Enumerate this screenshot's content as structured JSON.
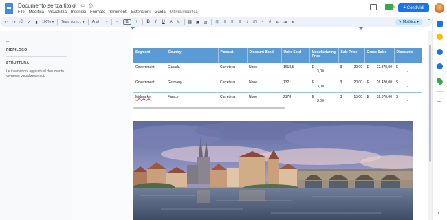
{
  "app": {
    "doc_title": "Documento senza titolo",
    "menu": [
      "File",
      "Modifica",
      "Visualizza",
      "Inserisci",
      "Formato",
      "Strumenti",
      "Estensioni",
      "Guida"
    ],
    "last_modified": "Ultima modifica"
  },
  "header": {
    "share_label": "Condividi"
  },
  "toolbar": {
    "zoom": "100%",
    "style": "Testo norm...",
    "font": "Arial",
    "font_size": "11",
    "mode": "Modifica"
  },
  "left_panel": {
    "summary_label": "RIEPILOGO",
    "structure_label": "STRUTTURA",
    "structure_hint": "Le intestazioni aggiunte al documento verranno visualizzate qui."
  },
  "table": {
    "headers": [
      "Segment",
      "Country",
      "Product",
      "Discount Band",
      "Units Sold",
      "Manufacturing Price",
      "Sale Price",
      "Gross Sales",
      "Discounts"
    ],
    "rows": [
      {
        "segment": "Government",
        "country": "Canada",
        "product": "Carretera",
        "discount_band": "None",
        "units_sold": "1618,5",
        "mfg_cur": "$",
        "mfg_val": "3,00",
        "sale_cur": "$",
        "sale_val": "20,00",
        "gross_cur": "$",
        "gross_val": "32.370,00",
        "disc_cur": "$",
        "disc_val": "-"
      },
      {
        "segment": "Government",
        "country": "Germany",
        "product": "Carretera",
        "discount_band": "None",
        "units_sold": "1321",
        "mfg_cur": "$",
        "mfg_val": "3,00",
        "sale_cur": "$",
        "sale_val": "20,00",
        "gross_cur": "$",
        "gross_val": "26.420,00",
        "disc_cur": "$",
        "disc_val": "-"
      },
      {
        "segment": "Midmarket",
        "country": "France",
        "product": "Carretera",
        "discount_band": "None",
        "units_sold": "2178",
        "mfg_cur": "$",
        "mfg_val": "3,00",
        "sale_cur": "$",
        "sale_val": "15,00",
        "gross_cur": "$",
        "gross_val": "32.670,00",
        "disc_cur": "$",
        "disc_val": "-"
      }
    ]
  },
  "colors": {
    "table_header": "#5b9bd5",
    "share_button": "#1a73e8",
    "toolbar_bg": "#edf2fa"
  }
}
